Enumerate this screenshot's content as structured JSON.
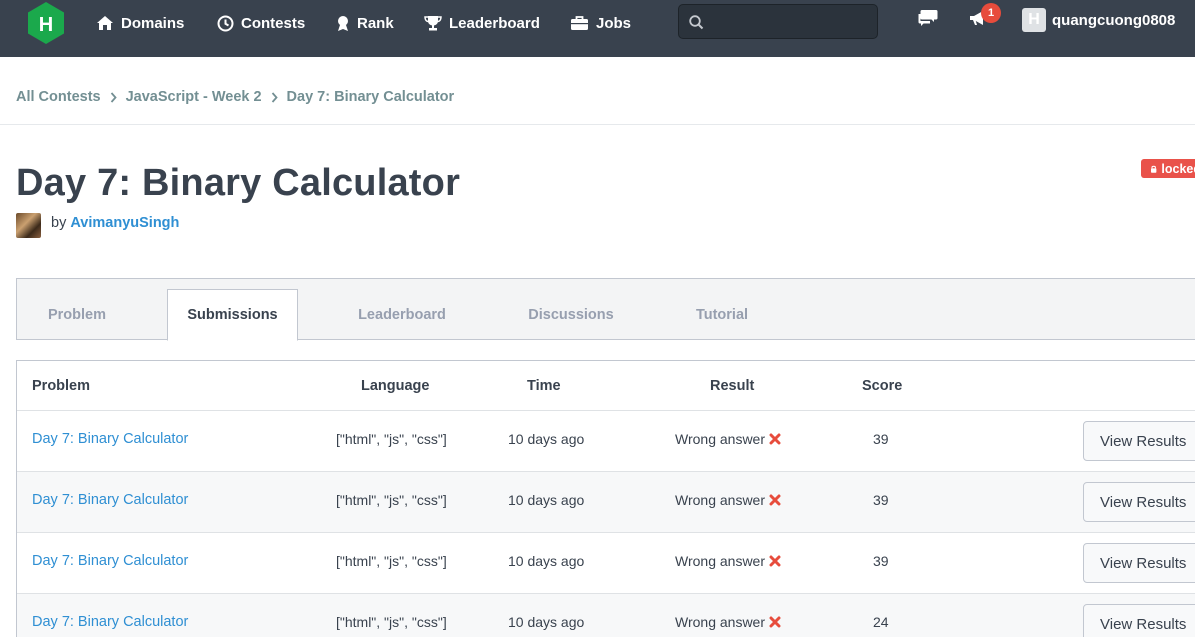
{
  "nav": {
    "logo_letter": "H",
    "items": [
      {
        "label": "Domains",
        "icon": "home-icon"
      },
      {
        "label": "Contests",
        "icon": "clock-icon"
      },
      {
        "label": "Rank",
        "icon": "medal-icon"
      },
      {
        "label": "Leaderboard",
        "icon": "trophy-icon"
      },
      {
        "label": "Jobs",
        "icon": "briefcase-icon"
      }
    ],
    "search_placeholder": "",
    "notification_count": "1",
    "username": "quangcuong0808",
    "user_avatar_letter": "H"
  },
  "breadcrumb": [
    "All Contests",
    "JavaScript - Week 2",
    "Day 7: Binary Calculator"
  ],
  "challenge": {
    "title": "Day 7: Binary Calculator",
    "by_prefix": "by",
    "author": "AvimanyuSingh",
    "status_badge": "locked"
  },
  "tabs": [
    {
      "label": "Problem",
      "active": false
    },
    {
      "label": "Submissions",
      "active": true
    },
    {
      "label": "Leaderboard",
      "active": false
    },
    {
      "label": "Discussions",
      "active": false
    },
    {
      "label": "Tutorial",
      "active": false
    }
  ],
  "table": {
    "headers": {
      "problem": "Problem",
      "language": "Language",
      "time": "Time",
      "result": "Result",
      "score": "Score"
    },
    "rows": [
      {
        "problem": "Day 7: Binary Calculator",
        "language": "[\"html\", \"js\", \"css\"]",
        "time": "10 days ago",
        "result": "Wrong answer",
        "score": "39",
        "action": "View Results"
      },
      {
        "problem": "Day 7: Binary Calculator",
        "language": "[\"html\", \"js\", \"css\"]",
        "time": "10 days ago",
        "result": "Wrong answer",
        "score": "39",
        "action": "View Results"
      },
      {
        "problem": "Day 7: Binary Calculator",
        "language": "[\"html\", \"js\", \"css\"]",
        "time": "10 days ago",
        "result": "Wrong answer",
        "score": "39",
        "action": "View Results"
      },
      {
        "problem": "Day 7: Binary Calculator",
        "language": "[\"html\", \"js\", \"css\"]",
        "time": "10 days ago",
        "result": "Wrong answer",
        "score": "24",
        "action": "View Results"
      }
    ]
  },
  "colors": {
    "nav_bg": "#39424e",
    "logo_green": "#1ba94c",
    "link_blue": "#2f8fd3",
    "error_red": "#e74c3c",
    "locked_red": "#e9524a"
  }
}
